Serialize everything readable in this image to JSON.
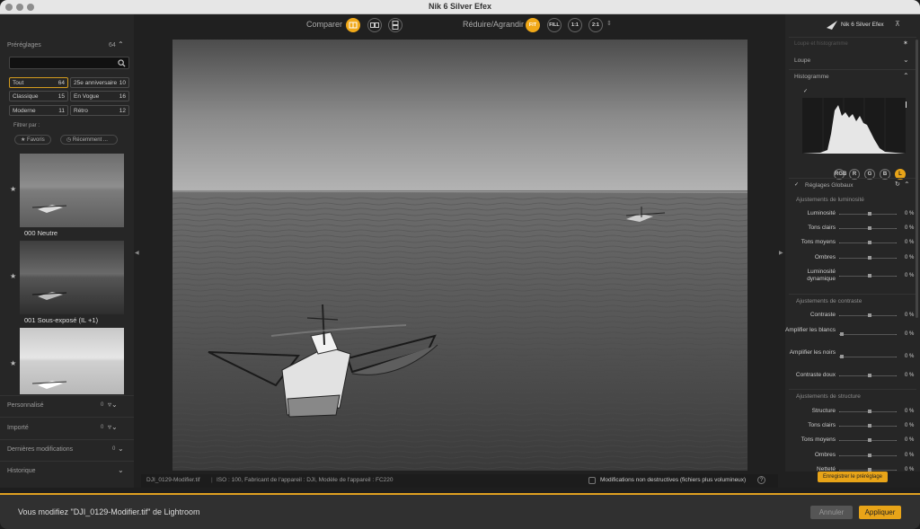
{
  "window": {
    "title": "Nik 6 Silver Efex"
  },
  "left": {
    "presets_title": "Préréglages",
    "presets_count": "64",
    "search_placeholder": "",
    "categories": [
      {
        "label": "Tout",
        "count": "64"
      },
      {
        "label": "25e anniversaire",
        "count": "10"
      },
      {
        "label": "Classique",
        "count": "15"
      },
      {
        "label": "En Vogue",
        "count": "16"
      },
      {
        "label": "Moderne",
        "count": "11"
      },
      {
        "label": "Rétro",
        "count": "12"
      }
    ],
    "filter_label": "Filtrer par :",
    "filter_favoris": "Favoris",
    "filter_recent": "Récemment ...",
    "presets": [
      {
        "name": "000 Neutre"
      },
      {
        "name": "001 Sous-exposé (IL +1)"
      },
      {
        "name": ""
      }
    ],
    "sections": [
      {
        "label": "Personnalisé",
        "count": "0"
      },
      {
        "label": "Importé",
        "count": "0"
      },
      {
        "label": "Dernières modifications",
        "count": "0"
      },
      {
        "label": "Historique",
        "count": ""
      }
    ]
  },
  "toolbar": {
    "compare_label": "Comparer",
    "zoom_label": "Réduire/Agrandir",
    "zoom_buttons": [
      "FIT",
      "FILL",
      "1:1",
      "2:1"
    ]
  },
  "status": {
    "filename": "DJI_0129-Modifier.tif",
    "meta": "ISO : 100, Fabricant de l'appareil : DJI, Modèle de l'appareil : FC220",
    "nondestructive": "Modifications non destructives (fichiers plus volumineux)",
    "help": "?"
  },
  "right": {
    "product": "Nik 6 Silver Efex",
    "loupe_hist": "Loupe et histogramme",
    "loupe": "Loupe",
    "histogram": "Histogramme",
    "channels": [
      "RGB",
      "R",
      "G",
      "B",
      "L"
    ],
    "global": "Réglages Globaux",
    "lum_title": "Ajustements de luminosité",
    "lum_sliders": [
      {
        "label": "Luminosité",
        "value": "0 %"
      },
      {
        "label": "Tons clairs",
        "value": "0 %"
      },
      {
        "label": "Tons moyens",
        "value": "0 %"
      },
      {
        "label": "Ombres",
        "value": "0 %"
      },
      {
        "label": "Luminosité dynamique",
        "value": "0 %"
      }
    ],
    "con_title": "Ajustements de contraste",
    "con_sliders": [
      {
        "label": "Contraste",
        "value": "0 %"
      },
      {
        "label": "Amplifier les blancs",
        "value": "0 %"
      },
      {
        "label": "Amplifier les noirs",
        "value": "0 %"
      },
      {
        "label": "Contraste doux",
        "value": "0 %"
      }
    ],
    "str_title": "Ajustements de structure",
    "str_sliders": [
      {
        "label": "Structure",
        "value": "0 %"
      },
      {
        "label": "Tons clairs",
        "value": "0 %"
      },
      {
        "label": "Tons moyens",
        "value": "0 %"
      },
      {
        "label": "Ombres",
        "value": "0 %"
      },
      {
        "label": "Netteté",
        "value": "0 %"
      }
    ],
    "save_preset": "Enregistrer le préréglage"
  },
  "bottom": {
    "message": "Vous modifiez \"DJI_0129-Modifier.tif\" de Lightroom",
    "cancel": "Annuler",
    "apply": "Appliquer"
  },
  "colors": {
    "accent": "#f0a818",
    "panel": "#262626"
  }
}
